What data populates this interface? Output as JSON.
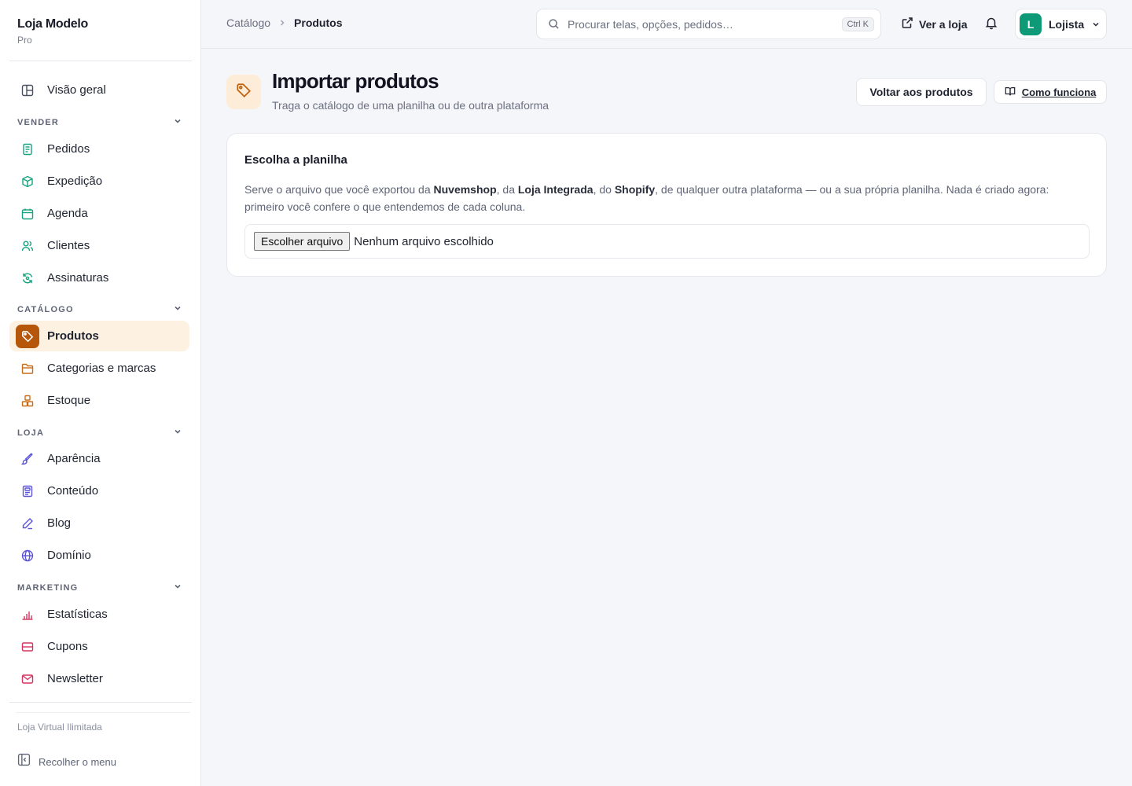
{
  "brand": {
    "name": "Loja Modelo",
    "plan": "Pro"
  },
  "nav": {
    "overview": "Visão geral",
    "sections": {
      "vender": {
        "label": "VENDER",
        "items": [
          "Pedidos",
          "Expedição",
          "Agenda",
          "Clientes",
          "Assinaturas"
        ]
      },
      "catalogo": {
        "label": "CATÁLOGO",
        "items": [
          "Produtos",
          "Categorias e marcas",
          "Estoque"
        ]
      },
      "loja": {
        "label": "LOJA",
        "items": [
          "Aparência",
          "Conteúdo",
          "Blog",
          "Domínio"
        ]
      },
      "marketing": {
        "label": "MARKETING",
        "items": [
          "Estatísticas",
          "Cupons",
          "Newsletter"
        ]
      }
    },
    "active": "Produtos",
    "footer_note": "Loja Virtual Ilimitada",
    "collapse_label": "Recolher o menu"
  },
  "topbar": {
    "breadcrumb": [
      "Catálogo",
      "Produtos"
    ],
    "search_placeholder": "Procurar telas, opções, pedidos…",
    "search_shortcut": "Ctrl K",
    "view_store": "Ver a loja",
    "user": {
      "initial": "L",
      "name": "Lojista"
    }
  },
  "page": {
    "title": "Importar produtos",
    "subtitle": "Traga o catálogo de uma planilha ou de outra plataforma",
    "back_button": "Voltar aos produtos",
    "help_button": "Como funciona"
  },
  "card": {
    "title": "Escolha a planilha",
    "desc": {
      "p1": "Serve o arquivo que você exportou da ",
      "b1": "Nuvemshop",
      "p2": ", da ",
      "b2": "Loja Integrada",
      "p3": ", do ",
      "b3": "Shopify",
      "p4": ", de qualquer outra plataforma — ou a sua própria planilha. Nada é criado agora: primeiro você confere o que entendemos de cada coluna."
    },
    "file_button": "Escolher arquivo",
    "file_status": "Nenhum arquivo escolhido"
  },
  "colors": {
    "accent": "#b5560b",
    "accent_bg": "#fdf1e2",
    "avatar": "#0f9a77"
  }
}
